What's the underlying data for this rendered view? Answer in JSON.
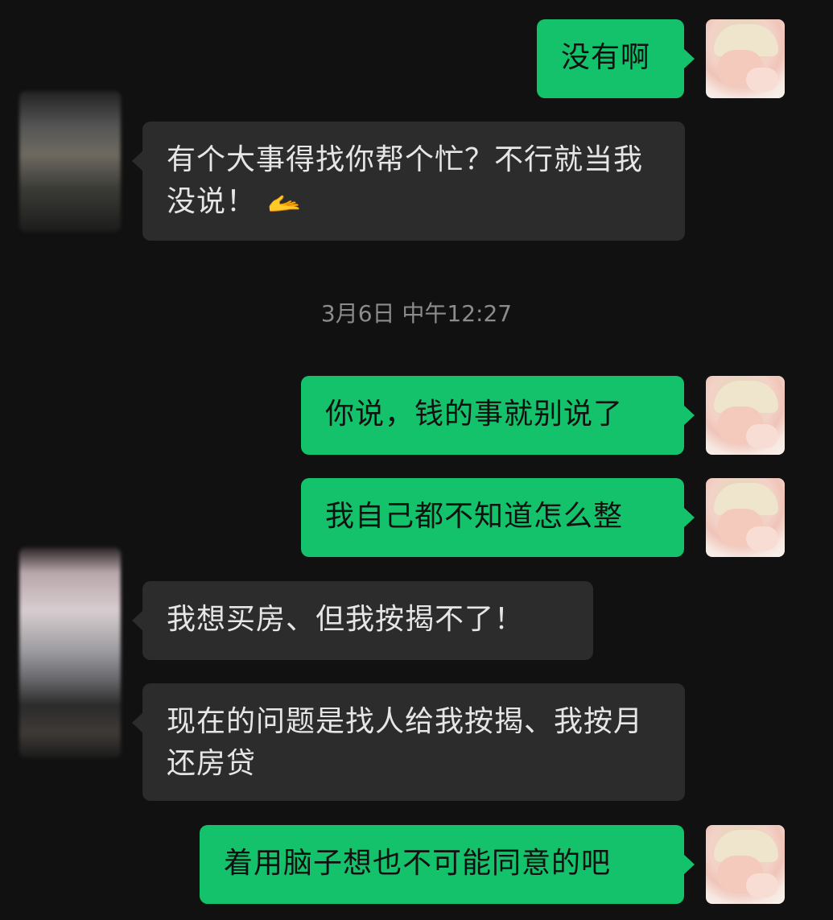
{
  "messages": [
    {
      "sender": "me",
      "text": "没有啊"
    },
    {
      "sender": "other",
      "text": "有个大事得找你帮个忙？不行就当我没说！",
      "emoji": "🫴"
    },
    {
      "sender": "me",
      "text": "你说，钱的事就别说了"
    },
    {
      "sender": "me",
      "text": "我自己都不知道怎么整"
    },
    {
      "sender": "other",
      "text": "我想买房、但我按揭不了！"
    },
    {
      "sender": "other",
      "text": "现在的问题是找人给我按揭、我按月还房贷"
    },
    {
      "sender": "me",
      "text": "着用脑子想也不可能同意的吧"
    }
  ],
  "timestamp": "3月6日 中午12:27",
  "colors": {
    "background": "#111111",
    "my_bubble": "#13c26a",
    "their_bubble": "#2c2c2c",
    "timestamp_text": "#8c8c8c"
  }
}
